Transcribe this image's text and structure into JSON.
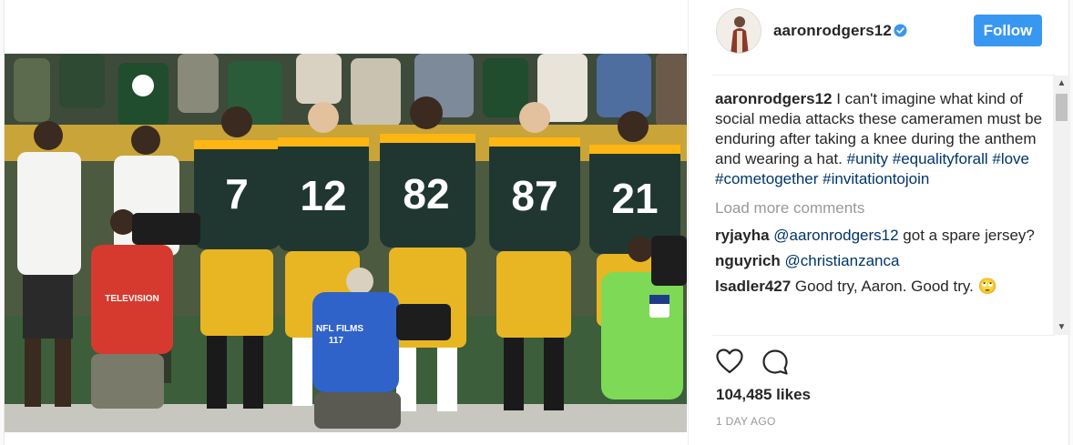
{
  "post": {
    "username": "aaronrodgers12",
    "follow_label": "Follow",
    "caption_text": "I can't imagine what kind of social media attacks these cameramen must be enduring after taking a knee during the anthem and wearing a hat.",
    "hashtags": [
      "#unity",
      "#equalityforall",
      "#love",
      "#cometogether",
      "#invitationtojoin"
    ],
    "load_more_label": "Load more comments",
    "comments": [
      {
        "user": "ryjayha",
        "text_mention": "@aaronrodgers12",
        "text": " got a spare jersey?"
      },
      {
        "user": "nguyrich",
        "text_mention": "@christianzanca",
        "text": ""
      },
      {
        "user": "lsadler427",
        "text_mention": "",
        "text": "Good try, Aaron. Good try. 🙄"
      }
    ],
    "likes": "104,485 likes",
    "time": "1 DAY AGO"
  },
  "photo": {
    "jersey_numbers": [
      "7",
      "12",
      "82",
      "87",
      "21"
    ],
    "camera_vest_text": "TELEVISION",
    "nfl_films_text": "NFL FILMS",
    "nfl_films_number": "117"
  },
  "colors": {
    "accent": "#3897f0",
    "packers_green": "#203731",
    "packers_gold": "#ffb612",
    "hashtag": "#003569"
  }
}
